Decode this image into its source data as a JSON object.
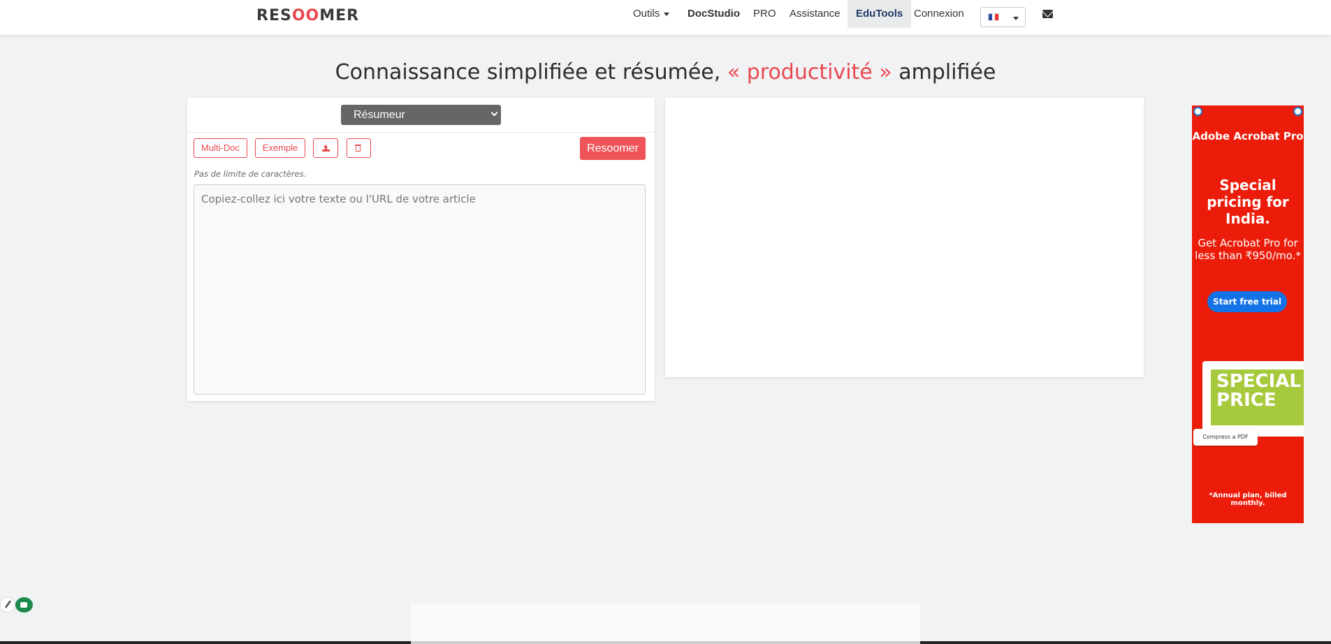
{
  "navbar": {
    "logo_prefix": "RES",
    "logo_oo": "OO",
    "logo_suffix": "MER",
    "items": [
      {
        "label": "Outils"
      },
      {
        "label": "DocStudio"
      },
      {
        "label": "PRO"
      },
      {
        "label": "Assistance"
      },
      {
        "label": "EduTools"
      },
      {
        "label": "Connexion"
      }
    ],
    "language_flag": "fr-flag-icon"
  },
  "headline": {
    "prefix": "Connaissance simplifiée et résumée, ",
    "accent": "« productivité »",
    "suffix": " amplifiée",
    "accent_color": "#e9484f"
  },
  "editor": {
    "mode_select_value": "Résumeur",
    "multidoc_label": "Multi-Doc",
    "example_label": "Exemple",
    "upload_icon": "upload-icon",
    "trash_icon": "trash-icon",
    "submit_label": "Resoomer",
    "limit_note": "Pas de limite de caractères.",
    "input_placeholder": "Copiez-collez ici votre texte ou l'URL de votre article",
    "input_value": ""
  },
  "ad": {
    "brand": "Adobe Acrobat Pro",
    "headline": "Special pricing for India.",
    "body": "Get Acrobat Pro for less than ₹950/mo.*",
    "cta": "Start free trial",
    "card_text": "SPECIAL PRICE",
    "compress_label": "Compress a PDF",
    "disclaimer": "*Annual plan, billed monthly.",
    "background_color": "#ec1c0a",
    "cta_color": "#1473e6"
  },
  "colors": {
    "accent": "#e9484f",
    "background": "#f1f2f4"
  }
}
